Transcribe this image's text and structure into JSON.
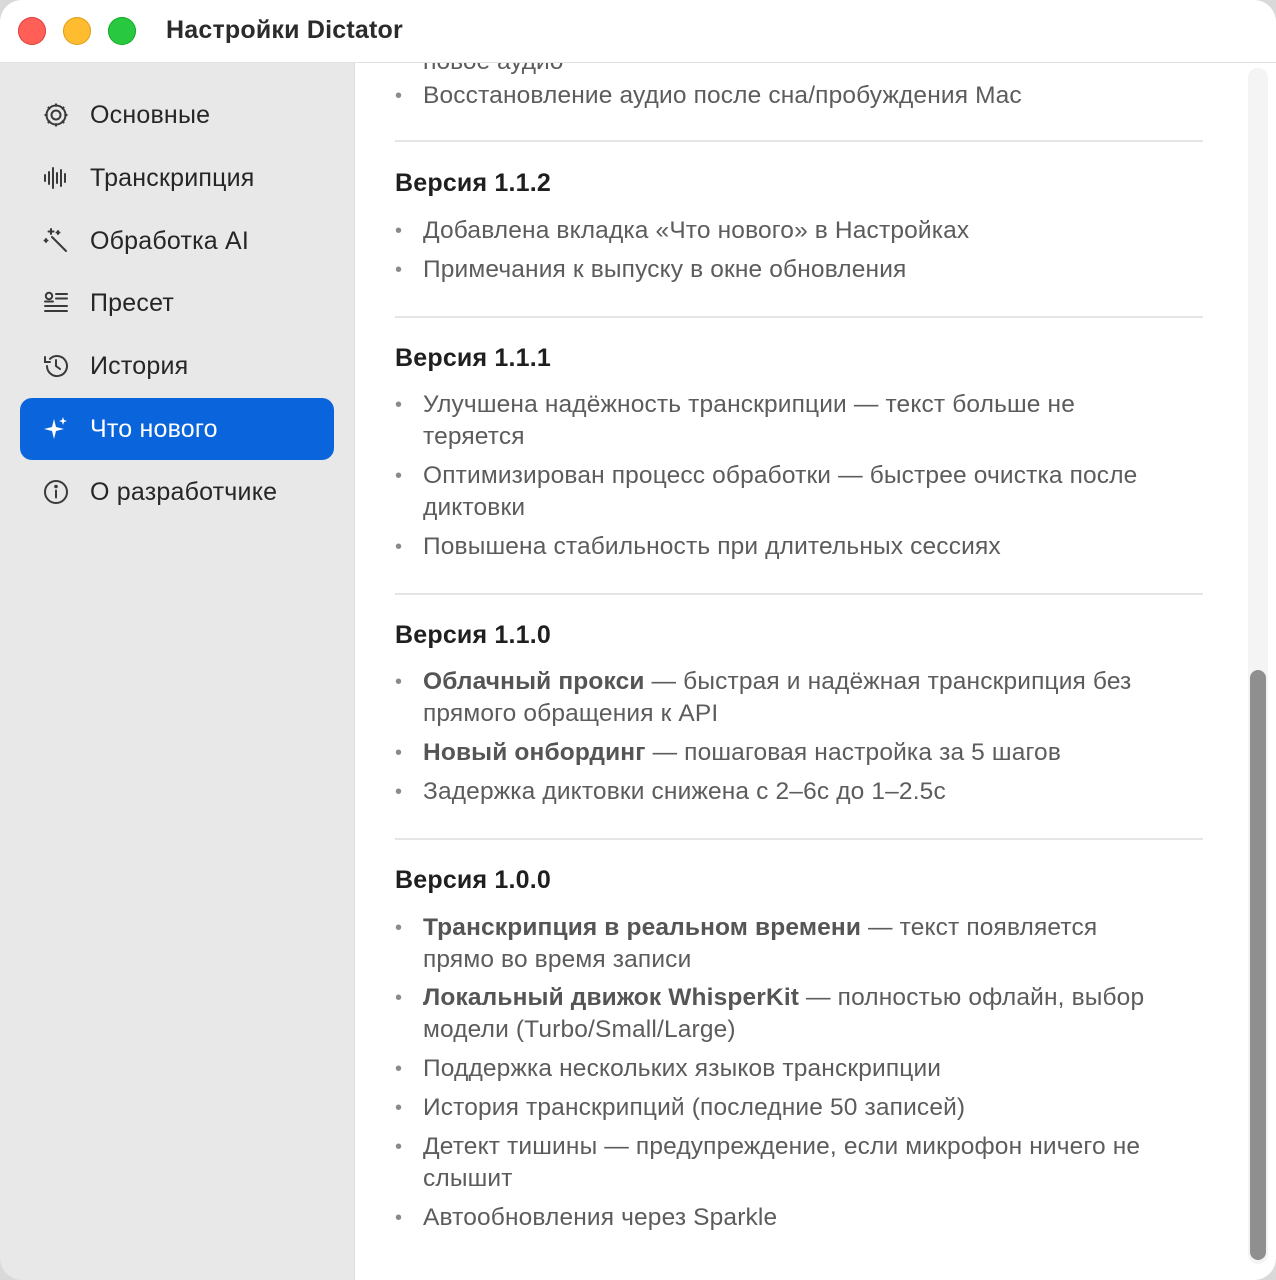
{
  "window": {
    "title": "Настройки Dictator"
  },
  "sidebar": {
    "items": [
      {
        "label": "Основные",
        "icon": "gear-icon"
      },
      {
        "label": "Транскрипция",
        "icon": "waveform-icon"
      },
      {
        "label": "Обработка AI",
        "icon": "magic-wand-icon"
      },
      {
        "label": "Пресет",
        "icon": "preset-list-icon"
      },
      {
        "label": "История",
        "icon": "history-clock-icon"
      },
      {
        "label": "Что нового",
        "icon": "sparkles-icon",
        "selected": true
      },
      {
        "label": "О разработчике",
        "icon": "info-icon"
      }
    ],
    "accent_color": "#0a64dc"
  },
  "content": {
    "clipped_top_text": "новое аудио",
    "top_bullets": [
      {
        "text": "Восстановление аудио после сна/пробуждения Mac"
      }
    ],
    "versions": [
      {
        "title": "Версия 1.1.2",
        "items": [
          {
            "bold": "",
            "text": "Добавлена вкладка «Что нового» в Настройках"
          },
          {
            "bold": "",
            "text": "Примечания к выпуску в окне обновления"
          }
        ]
      },
      {
        "title": "Версия 1.1.1",
        "items": [
          {
            "bold": "",
            "text": "Улучшена надёжность транскрипции — текст больше не теряется"
          },
          {
            "bold": "",
            "text": "Оптимизирован процесс обработки — быстрее очистка после диктовки"
          },
          {
            "bold": "",
            "text": "Повышена стабильность при длительных сессиях"
          }
        ]
      },
      {
        "title": "Версия 1.1.0",
        "items": [
          {
            "bold": "Облачный прокси",
            "text": " — быстрая и надёжная транскрипция без прямого обращения к API"
          },
          {
            "bold": "Новый онбординг",
            "text": " — пошаговая настройка за 5 шагов"
          },
          {
            "bold": "",
            "text": "Задержка диктовки снижена с 2–6с до 1–2.5с"
          }
        ]
      },
      {
        "title": "Версия 1.0.0",
        "items": [
          {
            "bold": "Транскрипция в реальном времени",
            "text": " — текст появляется прямо во время записи"
          },
          {
            "bold": "Локальный движок WhisperKit",
            "text": " — полностью офлайн, выбор модели (Turbo/Small/Large)"
          },
          {
            "bold": "",
            "text": "Поддержка нескольких языков транскрипции"
          },
          {
            "bold": "",
            "text": "История транскрипций (последние 50 записей)"
          },
          {
            "bold": "",
            "text": "Детект тишины — предупреждение, если микрофон ничего не слышит"
          },
          {
            "bold": "",
            "text": "Автообновления через Sparkle"
          }
        ]
      }
    ]
  }
}
